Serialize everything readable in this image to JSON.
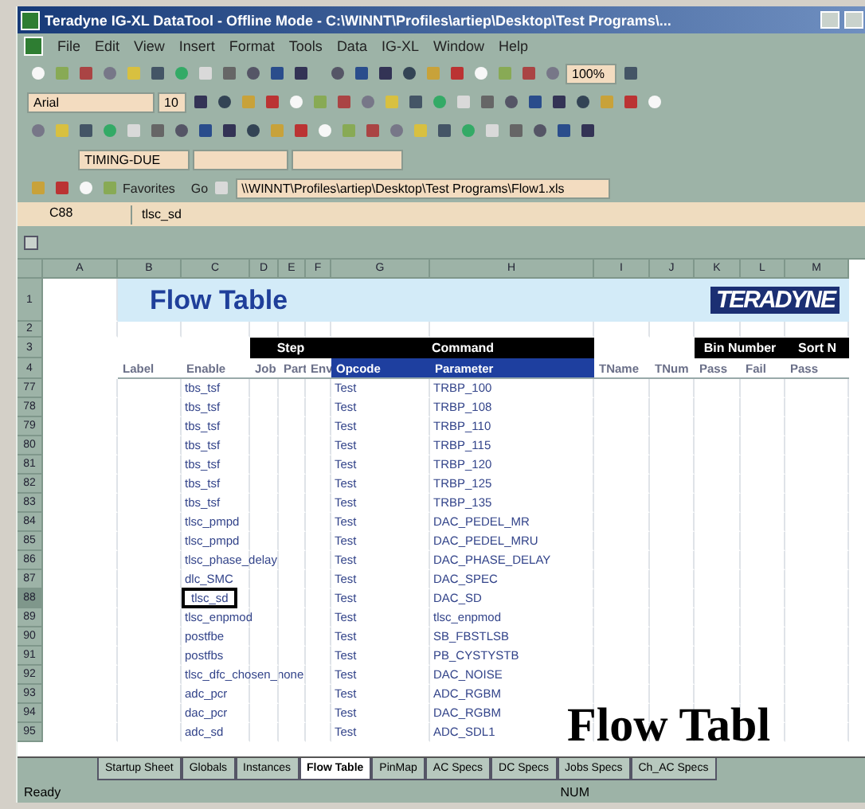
{
  "window": {
    "title": "Teradyne IG-XL DataTool - Offline Mode - C:\\WINNT\\Profiles\\artiep\\Desktop\\Test Programs\\..."
  },
  "menu": [
    "File",
    "Edit",
    "View",
    "Insert",
    "Format",
    "Tools",
    "Data",
    "IG-XL",
    "Window",
    "Help"
  ],
  "format_toolbar": {
    "font": "Arial",
    "size": "10",
    "zoom": "100%"
  },
  "igxl_toolbar": {
    "sheet_select": "TIMING-DUE"
  },
  "web_toolbar": {
    "favorites": "Favorites",
    "go": "Go",
    "address": "\\\\WINNT\\Profiles\\artiep\\Desktop\\Test Programs\\Flow1.xls"
  },
  "formula_bar": {
    "name_box": "C88",
    "content": "tlsc_sd"
  },
  "columns": [
    "A",
    "B",
    "C",
    "D",
    "E",
    "F",
    "G",
    "H",
    "I",
    "J",
    "K",
    "L",
    "M"
  ],
  "sheet": {
    "title": "Flow Table",
    "logo": "TERADYNE",
    "header_rows": [
      "1",
      "2",
      "3",
      "4"
    ],
    "column_groups": [
      {
        "kind": "plain",
        "columns": [
          "Label",
          "Enable"
        ]
      },
      {
        "kind": "group",
        "label": "Step",
        "columns": [
          "Job",
          "Part",
          "Env"
        ]
      },
      {
        "kind": "highlight",
        "label": "Command",
        "columns": [
          "Opcode",
          "Parameter"
        ]
      },
      {
        "kind": "plain",
        "columns": [
          "TName",
          "TNum"
        ]
      },
      {
        "kind": "group",
        "label": "Bin Number",
        "columns": [
          "Pass",
          "Fail"
        ]
      },
      {
        "kind": "group",
        "label": "Sort N",
        "columns": [
          "Pass"
        ]
      }
    ],
    "data_rows": [
      {
        "row": "77",
        "enable": "tbs_tsf",
        "opcode": "Test",
        "parameter": "TRBP_100",
        "selected": false
      },
      {
        "row": "78",
        "enable": "tbs_tsf",
        "opcode": "Test",
        "parameter": "TRBP_108",
        "selected": false
      },
      {
        "row": "79",
        "enable": "tbs_tsf",
        "opcode": "Test",
        "parameter": "TRBP_110",
        "selected": false
      },
      {
        "row": "80",
        "enable": "tbs_tsf",
        "opcode": "Test",
        "parameter": "TRBP_115",
        "selected": false
      },
      {
        "row": "81",
        "enable": "tbs_tsf",
        "opcode": "Test",
        "parameter": "TRBP_120",
        "selected": false
      },
      {
        "row": "82",
        "enable": "tbs_tsf",
        "opcode": "Test",
        "parameter": "TRBP_125",
        "selected": false
      },
      {
        "row": "83",
        "enable": "tbs_tsf",
        "opcode": "Test",
        "parameter": "TRBP_135",
        "selected": false
      },
      {
        "row": "84",
        "enable": "tlsc_pmpd",
        "opcode": "Test",
        "parameter": "DAC_PEDEL_MR",
        "selected": false
      },
      {
        "row": "85",
        "enable": "tlsc_pmpd",
        "opcode": "Test",
        "parameter": "DAC_PEDEL_MRU",
        "selected": false
      },
      {
        "row": "86",
        "enable": "tlsc_phase_delay",
        "opcode": "Test",
        "parameter": "DAC_PHASE_DELAY",
        "selected": false
      },
      {
        "row": "87",
        "enable": "dlc_SMC",
        "opcode": "Test",
        "parameter": "DAC_SPEC",
        "selected": false
      },
      {
        "row": "88",
        "enable": "tlsc_sd",
        "opcode": "Test",
        "parameter": "DAC_SD",
        "selected": true
      },
      {
        "row": "89",
        "enable": "tlsc_enpmod",
        "opcode": "Test",
        "parameter": "tlsc_enpmod",
        "selected": false
      },
      {
        "row": "90",
        "enable": "postfbe",
        "opcode": "Test",
        "parameter": "SB_FBSTLSB",
        "selected": false
      },
      {
        "row": "91",
        "enable": "postfbs",
        "opcode": "Test",
        "parameter": "PB_CYSTYSTB",
        "selected": false
      },
      {
        "row": "92",
        "enable": "tlsc_dfc_chosen_none",
        "opcode": "Test",
        "parameter": "DAC_NOISE",
        "selected": false
      },
      {
        "row": "93",
        "enable": "adc_pcr",
        "opcode": "Test",
        "parameter": "ADC_RGBM",
        "selected": false
      },
      {
        "row": "94",
        "enable": "dac_pcr",
        "opcode": "Test",
        "parameter": "DAC_RGBM",
        "selected": false
      },
      {
        "row": "95",
        "enable": "adc_sd",
        "opcode": "Test",
        "parameter": "ADC_SDL1",
        "selected": false
      }
    ]
  },
  "sheet_tabs": [
    {
      "label": "Startup Sheet",
      "selected": false
    },
    {
      "label": "Globals",
      "selected": false
    },
    {
      "label": "Instances",
      "selected": false
    },
    {
      "label": "Flow Table",
      "selected": true
    },
    {
      "label": "PinMap",
      "selected": false
    },
    {
      "label": "AC Specs",
      "selected": false
    },
    {
      "label": "DC Specs",
      "selected": false
    },
    {
      "label": "Jobs Specs",
      "selected": false
    },
    {
      "label": "Ch_AC Specs",
      "selected": false
    }
  ],
  "status_bar": {
    "left": "Ready",
    "right": "NUM"
  },
  "overlay_caption": "Flow Tabl"
}
